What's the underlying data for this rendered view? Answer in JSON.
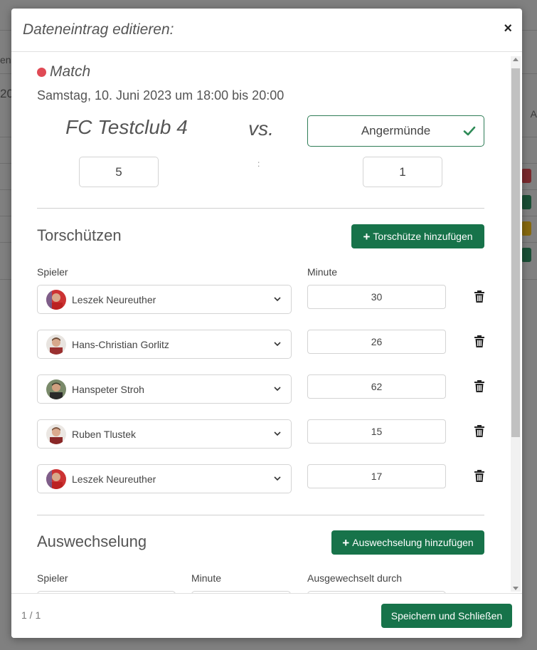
{
  "background": {
    "fragments": [
      "ene",
      "20",
      "A"
    ],
    "badge_colors": [
      "#c0393f",
      "#1f7a4d",
      "#d4a017",
      "#1f7a4d"
    ]
  },
  "modal": {
    "title": "Dateneintrag editieren:",
    "close_symbol": "×"
  },
  "event": {
    "type_label": "Match",
    "type_color": "#e04a55",
    "date_text": "Samstag, 10. Juni 2023 um 18:00 bis 20:00"
  },
  "match": {
    "home_team": "FC Testclub 4",
    "vs_label": "vs.",
    "away_team": "Angermünde",
    "home_score": "5",
    "away_score": "1",
    "score_separator": ":"
  },
  "scorers": {
    "title": "Torschützen",
    "add_button": "Torschütze hinzufügen",
    "col_player": "Spieler",
    "col_minute": "Minute",
    "rows": [
      {
        "player": "Leszek Neureuther",
        "minute": "30"
      },
      {
        "player": "Hans-Christian Gorlitz",
        "minute": "26"
      },
      {
        "player": "Hanspeter Stroh",
        "minute": "62"
      },
      {
        "player": "Ruben Tlustek",
        "minute": "15"
      },
      {
        "player": "Leszek Neureuther",
        "minute": "17"
      }
    ]
  },
  "substitutions": {
    "title": "Auswechselung",
    "add_button": "Auswechselung hinzufügen",
    "col_player": "Spieler",
    "col_minute": "Minute",
    "col_replaced_by": "Ausgewechselt durch"
  },
  "footer": {
    "pager": "1 / 1",
    "save_button": "Speichern und Schließen"
  },
  "colors": {
    "primary_green": "#17734a",
    "accent_red": "#e04a55"
  }
}
